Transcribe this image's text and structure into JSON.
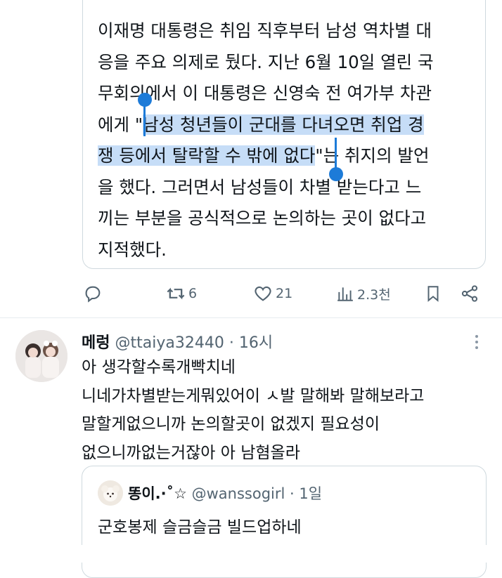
{
  "quoted_tweet": {
    "lines": [
      {
        "plain_before": "이재명 대통령은 취임 직후부터 남성 역차별 대",
        "selected": "",
        "plain_after": ""
      },
      {
        "plain_before": "응을 주요 의제로 뒀다. 지난 6월 10일 열린 국",
        "selected": "",
        "plain_after": ""
      },
      {
        "plain_before": "무회의에서 이 대통령은 신영숙 전 여가부 차관",
        "selected": "",
        "plain_after": ""
      },
      {
        "plain_before": "에게 \"",
        "selected": "남성 청년들이 군대를 다녀오면 취업 경",
        "plain_after": ""
      },
      {
        "plain_before": "",
        "selected": "쟁 등에서 탈락할 수 밖에 없다",
        "plain_after": "\"는 취지의 발언"
      },
      {
        "plain_before": "을 했다. 그러면서 남성들이 차별 받는다고 느",
        "selected": "",
        "plain_after": ""
      },
      {
        "plain_before": "끼는 부분을 공식적으로 논의하는 곳이 없다고",
        "selected": "",
        "plain_after": ""
      },
      {
        "plain_before": "지적했다.",
        "selected": "",
        "plain_after": ""
      }
    ]
  },
  "actions": {
    "reply_icon": "reply-icon",
    "retweet_count": "6",
    "like_count": "21",
    "views_count": "2.3천",
    "bookmark_icon": "bookmark-icon",
    "share_icon": "share-icon"
  },
  "reply": {
    "name": "메렁",
    "handle": "@ttaiya32440",
    "dot": "·",
    "time": "16시",
    "lines": [
      "아 생각할수록개빡치네",
      "니네가차별받는게뭐있어이 ㅅ발 말해봐 말해보라고",
      "말할게없으니까 논의할곳이 없겠지 필요성이",
      "없으니까없는거잖아 아 남혐올라"
    ]
  },
  "nested_quote": {
    "name": "똥이.·˚☆",
    "handle": "@wanssogirl",
    "dot": "·",
    "time": "1일",
    "lines": [
      "군호봉제 슬금슬금 빌드업하네"
    ]
  },
  "colors": {
    "text": "#0f1419",
    "secondary": "#536471",
    "border": "#cfd9de",
    "selection": "#c6ddf7",
    "handle": "#1d7bd8"
  }
}
